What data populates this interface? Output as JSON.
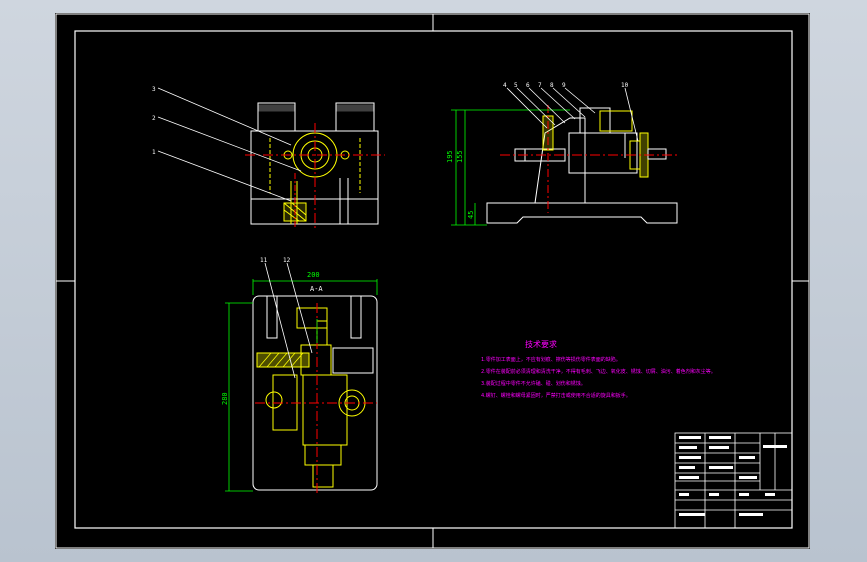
{
  "drawing": {
    "tech_title": "技术要求",
    "tech_notes": [
      "1.零件加工表面上，不应有划痕、擦伤等损伤零件表面的缺陷。",
      "2.零件在装配前必须清理和清洗干净，不得有毛刺、飞边、氧化皮、锈蚀、切屑、油污、着色剂和灰尘等。",
      "3.装配过程中零件不允许磕、碰、划伤和锈蚀。",
      "4.螺钉、螺栓和螺母紧固时，严禁打击或使用不合适的旋具和扳手。"
    ],
    "section_label": "A-A",
    "top_view_labels": [
      "3",
      "2",
      "1"
    ],
    "side_view_labels": [
      "4",
      "5",
      "6",
      "7",
      "8",
      "9",
      "10"
    ],
    "section_labels": [
      "11",
      "12"
    ],
    "dimensions": {
      "overall_width": "200",
      "overall_height": "280",
      "side_height_1": "195",
      "side_height_2": "155",
      "side_base": "45"
    },
    "colors": {
      "background": "#000000",
      "outline": "#ffffff",
      "part": "#ffff00",
      "dimension": "#00ff00",
      "centerline": "#ff0000",
      "leader": "#ffffff",
      "hatch": "#ffff00",
      "title_text": "#ff00ff"
    }
  }
}
